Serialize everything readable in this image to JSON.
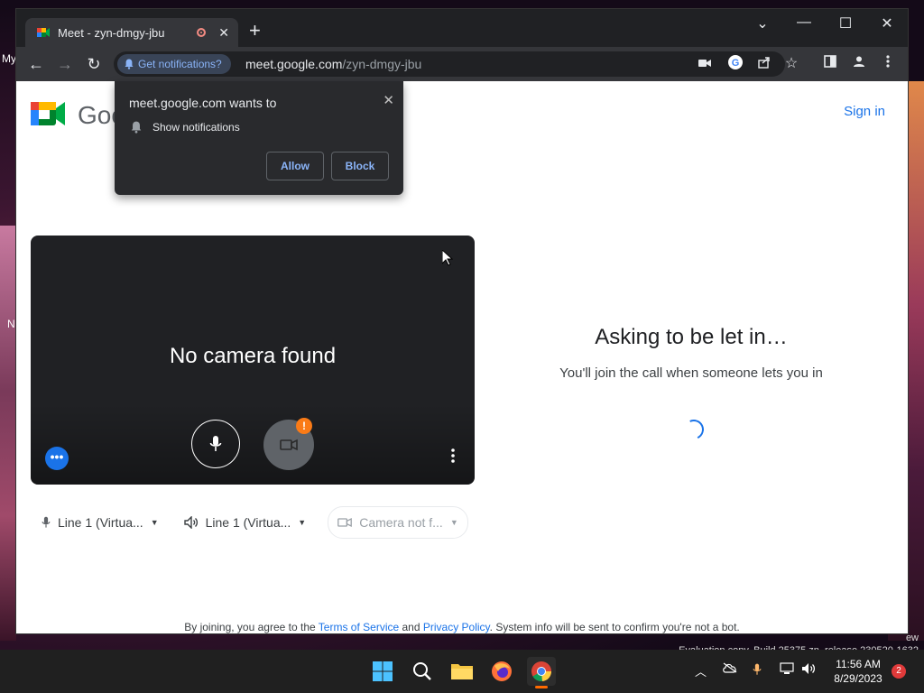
{
  "desktop": {
    "labels": [
      "My",
      "N"
    ],
    "watermark_line1": "ew",
    "watermark_line2": "Evaluation copy. Build 25375.zn_release.230520-1632"
  },
  "browser": {
    "tab_title": "Meet - zyn-dmgy-jbu",
    "tab_close": "✕",
    "new_tab": "+",
    "window_controls": {
      "dropdown": "⌄",
      "minimize": "—",
      "maximize": "☐",
      "close": "✕"
    },
    "nav": {
      "back": "←",
      "forward": "→",
      "reload": "↻"
    },
    "notification_chip": "Get notifications?",
    "url_host": "meet.google.com",
    "url_path": "/zyn-dmgy-jbu",
    "icons": [
      "camera-icon",
      "google-icon",
      "share-icon",
      "star-icon",
      "sidepanel-icon",
      "profile-icon",
      "menu-icon"
    ]
  },
  "popup": {
    "title": "meet.google.com wants to",
    "permission": "Show notifications",
    "allow": "Allow",
    "block": "Block",
    "close": "✕"
  },
  "meet": {
    "logo_text": "Goo",
    "sign_in": "Sign in",
    "preview_message": "No camera found",
    "camera_warning": "!",
    "devices": {
      "mic": "Line 1 (Virtua...",
      "speaker": "Line 1 (Virtua...",
      "camera": "Camera not f..."
    },
    "status_title": "Asking to be let in…",
    "status_message": "You'll join the call when someone lets you in",
    "footer_prefix": "By joining, you agree to the",
    "footer_terms": "Terms of Service",
    "footer_and": "and",
    "footer_privacy": "Privacy Policy",
    "footer_suffix": ". System info will be sent to confirm you're not a bot."
  },
  "taskbar": {
    "time": "11:56 AM",
    "date": "8/29/2023",
    "notification_count": "2",
    "accent": "#ff6a00"
  }
}
